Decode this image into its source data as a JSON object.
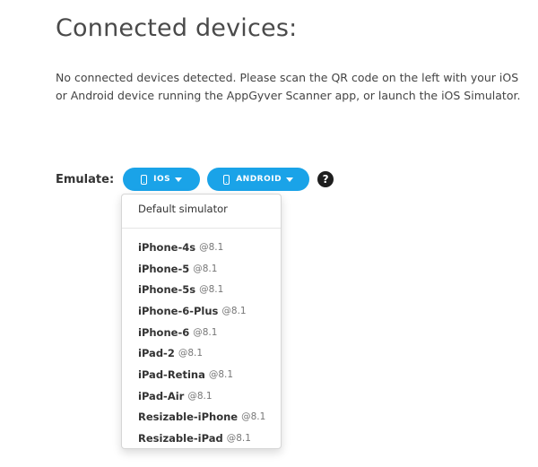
{
  "header": {
    "title": "Connected devices:"
  },
  "message": "No connected devices detected. Please scan the QR code on the left with your iOS or Android device running the AppGyver Scanner app, or launch the iOS Simulator.",
  "emulate": {
    "label": "Emulate:",
    "ios_button_label": "IOS",
    "android_button_label": "ANDROID",
    "help_glyph": "?"
  },
  "dropdown": {
    "default_item": "Default simulator",
    "devices": [
      {
        "name": "iPhone-4s",
        "version": "@8.1"
      },
      {
        "name": "iPhone-5",
        "version": "@8.1"
      },
      {
        "name": "iPhone-5s",
        "version": "@8.1"
      },
      {
        "name": "iPhone-6-Plus",
        "version": "@8.1"
      },
      {
        "name": "iPhone-6",
        "version": "@8.1"
      },
      {
        "name": "iPad-2",
        "version": "@8.1"
      },
      {
        "name": "iPad-Retina",
        "version": "@8.1"
      },
      {
        "name": "iPad-Air",
        "version": "@8.1"
      },
      {
        "name": "Resizable-iPhone",
        "version": "@8.1"
      },
      {
        "name": "Resizable-iPad",
        "version": "@8.1"
      }
    ]
  },
  "colors": {
    "accent": "#1aa3e8",
    "text": "#333333",
    "help_icon_bg": "#1e1e1e"
  },
  "icons": {
    "ios_button": "phone-icon",
    "android_button": "phone-icon",
    "dropdown_caret": "caret-down-icon",
    "help": "question-circle-icon"
  }
}
